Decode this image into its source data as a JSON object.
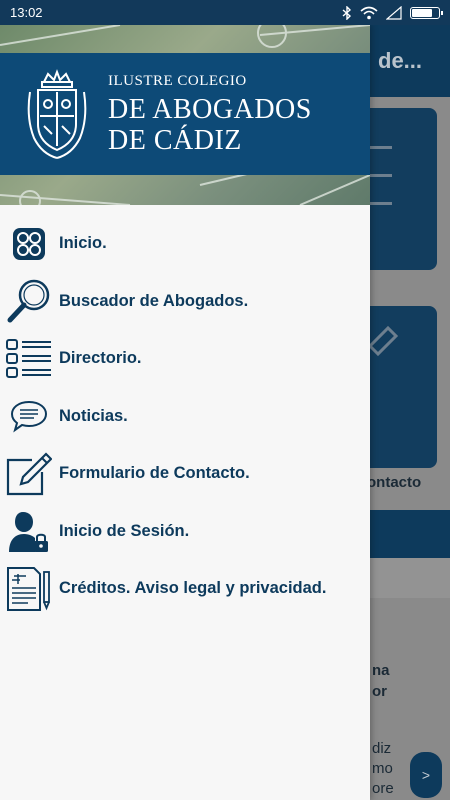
{
  "status_bar": {
    "time": "13:02"
  },
  "background": {
    "header_title": "de...",
    "card_label": "ontacto",
    "snippet_bold_lines": [
      "na",
      "or"
    ],
    "snippet_lines": [
      "diz",
      "mo",
      "ore"
    ],
    "next_button": ">"
  },
  "drawer": {
    "brand": {
      "line1": "ILUSTRE COLEGIO",
      "line2": "DE ABOGADOS",
      "line3": "DE CÁDIZ"
    },
    "items": [
      {
        "label": "Inicio.",
        "icon": "grid-icon"
      },
      {
        "label": "Buscador de Abogados.",
        "icon": "magnifier-icon"
      },
      {
        "label": "Directorio.",
        "icon": "list-icon"
      },
      {
        "label": "Noticias.",
        "icon": "chat-bubble-icon"
      },
      {
        "label": "Formulario de Contacto.",
        "icon": "pencil-edit-icon"
      },
      {
        "label": "Inicio de Sesión.",
        "icon": "user-lock-icon"
      },
      {
        "label": "Créditos. Aviso legal y privacidad.",
        "icon": "legal-document-icon"
      }
    ]
  },
  "colors": {
    "primary": "#0d3a5c",
    "brand_band": "#0d4a77",
    "drawer_bg": "#f7f7f7"
  }
}
